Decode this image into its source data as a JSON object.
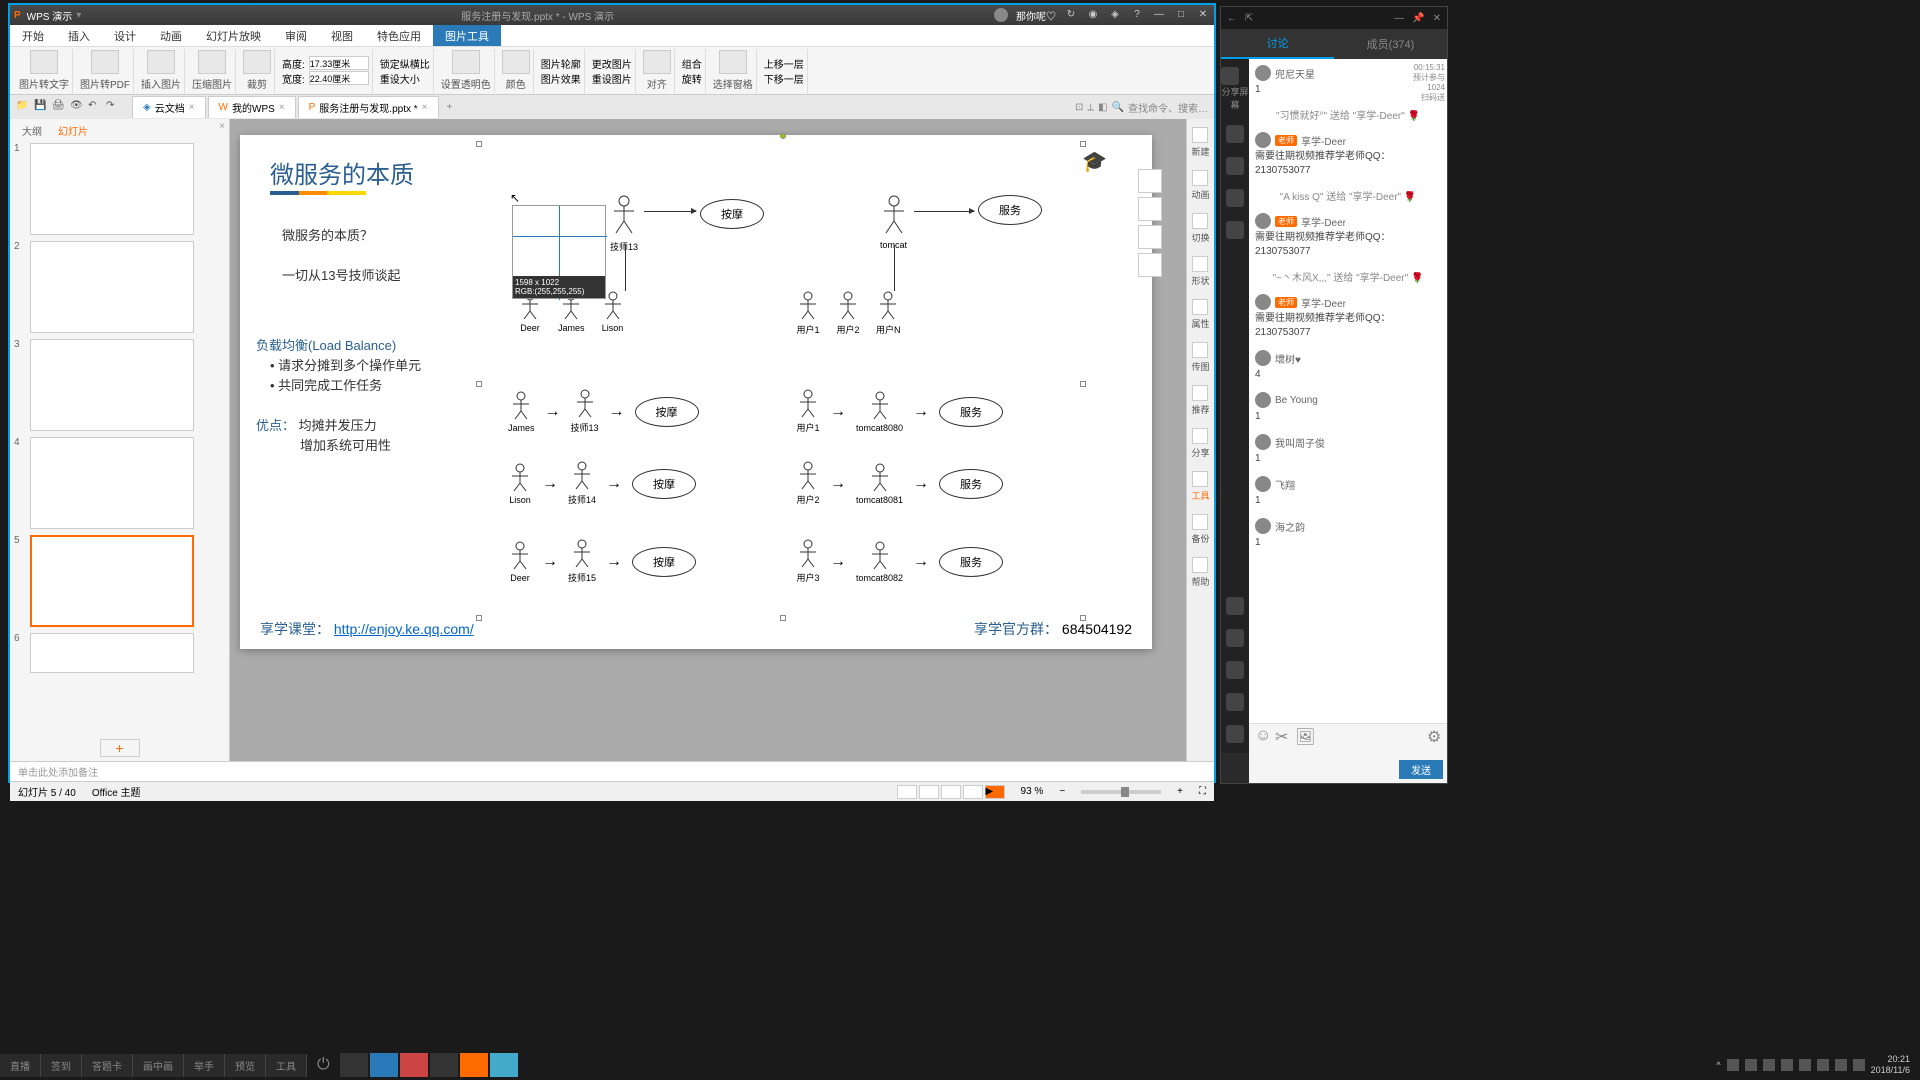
{
  "wps": {
    "app_name": "WPS 演示",
    "title_doc": "服务注册与发现.pptx * - WPS 演示",
    "title_user": "那你呢♡",
    "menu": [
      "开始",
      "插入",
      "设计",
      "动画",
      "幻灯片放映",
      "审阅",
      "视图",
      "特色应用",
      "图片工具"
    ],
    "toolbar": {
      "img2text": "图片转文字",
      "img2pdf": "图片转PDF",
      "insert_img": "插入图片",
      "compress": "压缩图片",
      "crop": "裁剪",
      "height_label": "高度:",
      "height_val": "17.33厘米",
      "width_label": "宽度:",
      "width_val": "22.40厘米",
      "lock_ratio": "锁定纵横比",
      "reset_size": "重设大小",
      "set_trans": "设置透明色",
      "color": "颜色",
      "pic_outline": "图片轮廓",
      "pic_effect": "图片效果",
      "change_pic": "更改图片",
      "reset_pic": "重设图片",
      "align": "对齐",
      "rotate": "旋转",
      "combine": "组合",
      "sel_pane": "选择窗格",
      "bring_fwd": "上移一层",
      "send_back": "下移一层"
    },
    "tabs": {
      "cloud": "云文档",
      "mywps": "我的WPS",
      "doc": "服务注册与发现.pptx *"
    },
    "search_hint": "查找命令、搜索…",
    "outline": {
      "tab1": "大纲",
      "tab2": "幻灯片"
    },
    "slide": {
      "title": "微服务的本质",
      "q1": "微服务的本质？",
      "q2": "一切从13号技师谈起",
      "lb_title": "负载均衡(Load Balance)",
      "lb1": "请求分摊到多个操作单元",
      "lb2": "共同完成工作任务",
      "adv_label": "优点：",
      "adv1": "均摊并发压力",
      "adv2": "增加系统可用性",
      "names": {
        "deer": "Deer",
        "james": "James",
        "lison": "Lison",
        "tech13": "技师13",
        "tech14": "技师14",
        "tech15": "技师15",
        "tomcat": "tomcat",
        "user1": "用户1",
        "user2": "用户2",
        "usern": "用户N",
        "tc8080": "tomcat8080",
        "tc8081": "tomcat8081",
        "tc8082": "tomcat8082",
        "user3": "用户3"
      },
      "massage": "按摩",
      "service": "服务",
      "footer_left": "享学课堂：",
      "footer_url": "http://enjoy.ke.qq.com/",
      "footer_right_label": "享学官方群：",
      "footer_right_num": "684504192"
    },
    "picker": {
      "size": "1598 x 1022",
      "rgb": "RGB:(255,255,255)"
    },
    "sidepanel": [
      "新建",
      "动画",
      "切换",
      "形状",
      "属性",
      "传图",
      "推荐",
      "分享",
      "工具",
      "备份",
      "帮助"
    ],
    "notes_hint": "单击此处添加备注",
    "status": {
      "slide": "幻灯片 5 / 40",
      "theme": "Office 主题",
      "zoom": "93 %"
    }
  },
  "chat": {
    "share_screen": "分享屏幕",
    "tabs": {
      "discuss": "讨论",
      "members": "成员(374)"
    },
    "messages": [
      {
        "user": "兜尼天星",
        "text": "1"
      },
      {
        "gift": "\"习惯就好°\" 送给 \"享学-Deer\" 🌹"
      },
      {
        "user": "享学-Deer",
        "badge": "老师",
        "text": "需要往期视频推荐学老师QQ：2130753077"
      },
      {
        "gift": "\"A kiss Q\" 送给 \"享学-Deer\" 🌹"
      },
      {
        "user": "享学-Deer",
        "badge": "老师",
        "text": "需要往期视频推荐学老师QQ：2130753077"
      },
      {
        "gift": "\"~丶木风X,,,\" 送给 \"享学-Deer\" 🌹"
      },
      {
        "user": "享学-Deer",
        "badge": "老师",
        "text": "需要往期视频推荐学老师QQ：2130753077"
      },
      {
        "user": "壞树♥",
        "text": "4"
      },
      {
        "user": "Be Young",
        "text": "1"
      },
      {
        "user": "我叫周子俊",
        "text": "1"
      },
      {
        "user": "飞翔",
        "text": "1"
      },
      {
        "user": "海之韵",
        "text": "1"
      }
    ],
    "timer": "00:15:31",
    "stats": "预计参与\n1024\n扫码送",
    "send": "发送"
  },
  "taskbar": {
    "tabs": [
      "直播",
      "签到",
      "答题卡",
      "画中画",
      "举手",
      "预览",
      "工具"
    ],
    "clock_time": "20:21",
    "clock_date": "2018/11/6"
  }
}
